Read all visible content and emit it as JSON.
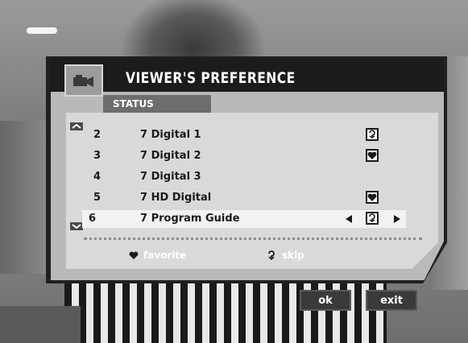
{
  "osd": {
    "title": "VIEWER'S PREFERENCE",
    "section_tab": "STATUS",
    "channels": [
      {
        "number": "2",
        "name": "7 Digital 1",
        "status_icon": "skip-icon"
      },
      {
        "number": "3",
        "name": "7 Digital 2",
        "status_icon": "favorite-icon"
      },
      {
        "number": "4",
        "name": "7 Digital 3",
        "status_icon": ""
      },
      {
        "number": "5",
        "name": "7 HD Digital",
        "status_icon": "favorite-icon"
      },
      {
        "number": "6",
        "name": "7 Program Guide",
        "status_icon": "skip-icon",
        "selected": true
      }
    ],
    "legend": {
      "favorite_label": "favorite",
      "skip_label": "skip"
    },
    "buttons": {
      "ok_label": "ok",
      "exit_label": "exit"
    }
  },
  "colors": {
    "panel_dark": "#1c1c1c",
    "panel_body": "#b9b9b9",
    "list_bg": "#d9d9d9",
    "selected_row": "#f2f2f2",
    "tab": "#6d6d6d"
  }
}
